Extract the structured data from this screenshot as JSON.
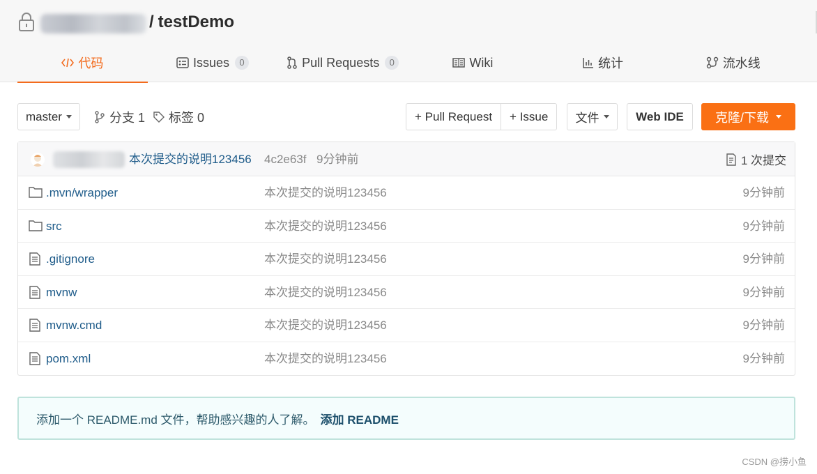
{
  "header": {
    "repo_name": "testDemo",
    "slash": "/"
  },
  "tabs": [
    {
      "label": "代码",
      "icon": "code-icon",
      "active": true
    },
    {
      "label": "Issues",
      "icon": "issues-icon",
      "count": "0"
    },
    {
      "label": "Pull Requests",
      "icon": "pull-request-icon",
      "count": "0"
    },
    {
      "label": "Wiki",
      "icon": "wiki-book-icon"
    },
    {
      "label": "统计",
      "icon": "stats-chart-icon"
    },
    {
      "label": "流水线",
      "icon": "pipeline-icon"
    }
  ],
  "toolbar": {
    "branch": "master",
    "branches_label": "分支 1",
    "tags_label": "标签 0",
    "new_pr": "+ Pull Request",
    "new_issue": "+ Issue",
    "file_menu": "文件",
    "web_ide": "Web IDE",
    "clone": "克隆/下载"
  },
  "commit": {
    "message": "本次提交的说明123456",
    "sha": "4c2e63f",
    "time": "9分钟前",
    "count_label": "1 次提交"
  },
  "files": [
    {
      "name": ".mvn/wrapper",
      "type": "folder",
      "message": "本次提交的说明123456",
      "time": "9分钟前"
    },
    {
      "name": "src",
      "type": "folder",
      "message": "本次提交的说明123456",
      "time": "9分钟前"
    },
    {
      "name": ".gitignore",
      "type": "file",
      "message": "本次提交的说明123456",
      "time": "9分钟前"
    },
    {
      "name": "mvnw",
      "type": "file",
      "message": "本次提交的说明123456",
      "time": "9分钟前"
    },
    {
      "name": "mvnw.cmd",
      "type": "file",
      "message": "本次提交的说明123456",
      "time": "9分钟前"
    },
    {
      "name": "pom.xml",
      "type": "file",
      "message": "本次提交的说明123456",
      "time": "9分钟前"
    }
  ],
  "readme": {
    "notice": "添加一个 README.md 文件，帮助感兴趣的人了解。",
    "link": "添加 README"
  },
  "watermark": "CSDN @捞小鱼",
  "colors": {
    "accent": "#f36b1d",
    "clone_button": "#fa7014",
    "link": "#1f5c8a"
  }
}
